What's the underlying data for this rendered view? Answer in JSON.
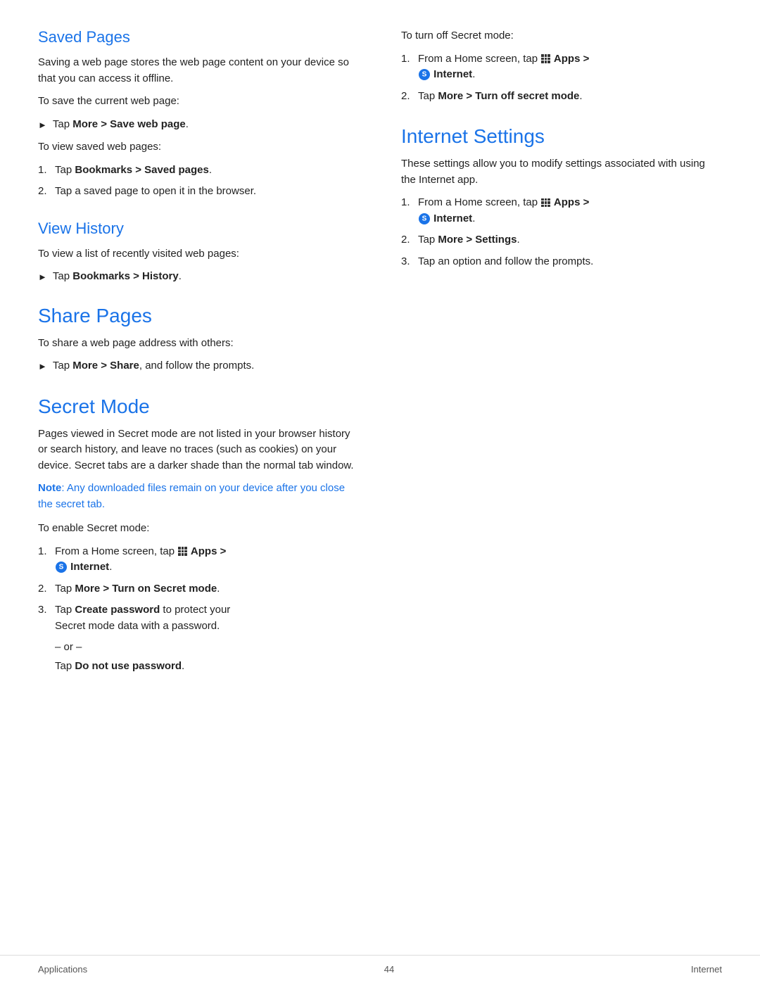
{
  "left": {
    "saved_pages": {
      "title": "Saved Pages",
      "intro": "Saving a web page stores the web page content on your device so that you can access it offline.",
      "save_instruction": "To save the current web page:",
      "save_step": "Tap More > Save web page.",
      "view_instruction": "To view saved web pages:",
      "view_steps": [
        "Tap Bookmarks > Saved pages.",
        "Tap a saved page to open it in the browser."
      ]
    },
    "view_history": {
      "title": "View History",
      "instruction": "To view a list of recently visited web pages:",
      "step": "Tap Bookmarks > History."
    },
    "share_pages": {
      "title": "Share Pages",
      "instruction": "To share a web page address with others:",
      "step": "Tap More > Share, and follow the prompts."
    },
    "secret_mode": {
      "title": "Secret Mode",
      "intro": "Pages viewed in Secret mode are not listed in your browser history or search history, and leave no traces (such as cookies) on your device. Secret tabs are a darker shade than the normal tab window.",
      "note": "Note: Any downloaded files remain on your device after you close the secret tab.",
      "enable_instruction": "To enable Secret mode:",
      "enable_steps": [
        {
          "num": "1.",
          "text": "From a Home screen, tap  Apps > Internet."
        },
        {
          "num": "2.",
          "text": "Tap More > Turn on Secret mode."
        },
        {
          "num": "3.",
          "text": "Tap Create password to protect your Secret mode data with a password."
        }
      ],
      "or_text": "– or –",
      "final_step": "Tap Do not use password."
    }
  },
  "right": {
    "turn_off_section": {
      "instruction": "To turn off Secret mode:",
      "steps": [
        {
          "num": "1.",
          "text": "From a Home screen, tap  Apps > Internet."
        },
        {
          "num": "2.",
          "text": "Tap More > Turn off secret mode."
        }
      ]
    },
    "internet_settings": {
      "title": "Internet Settings",
      "intro": "These settings allow you to modify settings associated with using the Internet app.",
      "steps": [
        {
          "num": "1.",
          "text": "From a Home screen, tap  Apps > Internet."
        },
        {
          "num": "2.",
          "text": "Tap More > Settings."
        },
        {
          "num": "3.",
          "text": "Tap an option and follow the prompts."
        }
      ]
    }
  },
  "footer": {
    "left": "Applications",
    "center": "44",
    "right": "Internet"
  }
}
